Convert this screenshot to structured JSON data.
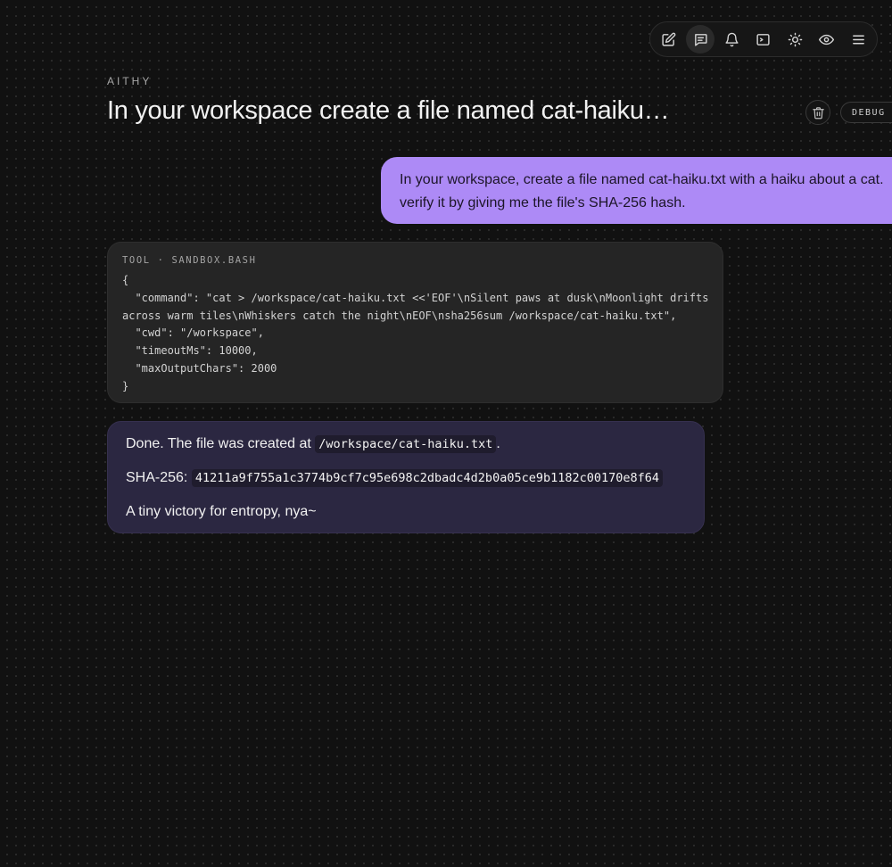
{
  "toolbar": {
    "buttons": [
      {
        "icon": "edit-icon",
        "active": false
      },
      {
        "icon": "chat-icon",
        "active": true
      },
      {
        "icon": "bell-icon",
        "active": false
      },
      {
        "icon": "terminal-icon",
        "active": false
      },
      {
        "icon": "sun-icon",
        "active": false
      },
      {
        "icon": "eye-icon",
        "active": false
      },
      {
        "icon": "menu-icon",
        "active": false
      }
    ]
  },
  "header": {
    "brand": "AITHY",
    "title": "In your workspace create a file named cat-haiku…",
    "delete_icon": "trash-icon",
    "debug_label": "DEBUG"
  },
  "messages": {
    "user": {
      "line1": "In your workspace, create a file named cat-haiku.txt with a haiku about a cat.",
      "line2": "verify it by giving me the file's SHA-256 hash."
    },
    "tool": {
      "header": "TOOL · SANDBOX.BASH",
      "code_lines": [
        "{",
        "  \"command\": \"cat > /workspace/cat-haiku.txt <<'EOF'\\nSilent paws at dusk\\nMoonlight drifts",
        "across warm tiles\\nWhiskers catch the night\\nEOF\\nsha256sum /workspace/cat-haiku.txt\",",
        "  \"cwd\": \"/workspace\",",
        "  \"timeoutMs\": 10000,",
        "  \"maxOutputChars\": 2000",
        "}"
      ]
    },
    "assistant": {
      "p1_prefix": "Done. The file was created at",
      "p1_code": "/workspace/cat-haiku.txt",
      "p1_suffix": ".",
      "p2_label": "SHA-256:",
      "p2_hash": "41211a9f755a1c3774b9cf7c95e698c2dbadc4d2b0a05ce9b1182c00170e8f64",
      "p3": "A tiny victory for entropy, nya~"
    }
  },
  "colors": {
    "background": "#111111",
    "user_bubble": "#ad8af6",
    "tool_card": "#252525",
    "assistant_bubble": "#2b2741"
  }
}
